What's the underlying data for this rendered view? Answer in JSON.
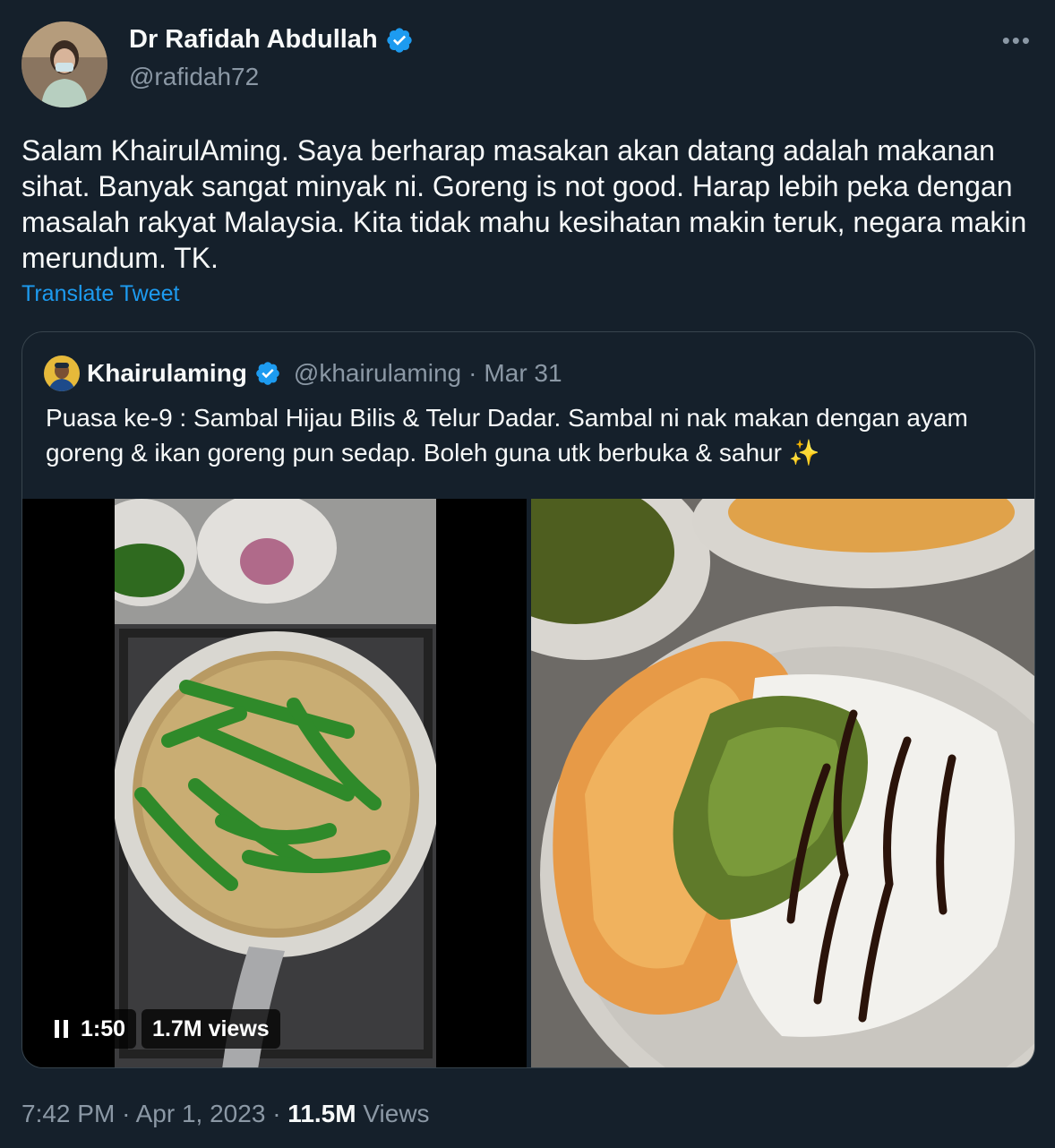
{
  "author": {
    "name": "Dr Rafidah Abdullah",
    "handle": "@rafidah72"
  },
  "menu": {
    "more_label": "•••"
  },
  "tweet": {
    "text": "Salam KhairulAming. Saya berharap masakan akan datang adalah makanan sihat. Banyak sangat minyak ni. Goreng is not good. Harap lebih peka dengan masalah rakyat Malaysia. Kita tidak mahu kesihatan makin teruk, negara makin merundum. TK.",
    "translate_label": "Translate Tweet"
  },
  "quoted": {
    "name": "Khairulaming",
    "handle": "@khairulaming",
    "separator": "·",
    "date": "Mar 31",
    "text": "Puasa ke-9 : Sambal Hijau Bilis & Telur Dadar. Sambal ni nak makan dengan ayam goreng & ikan goreng pun sedap. Boleh guna utk berbuka & sahur ✨",
    "video": {
      "time": "1:50",
      "views": "1.7M views"
    }
  },
  "footer": {
    "time": "7:42 PM",
    "sep1": "·",
    "date": "Apr 1, 2023",
    "sep2": "·",
    "views_count": "11.5M",
    "views_label": "Views"
  },
  "colors": {
    "background": "#15202b",
    "link": "#1d9bf0",
    "secondary_text": "#8b98a5",
    "verified": "#1d9bf0"
  }
}
